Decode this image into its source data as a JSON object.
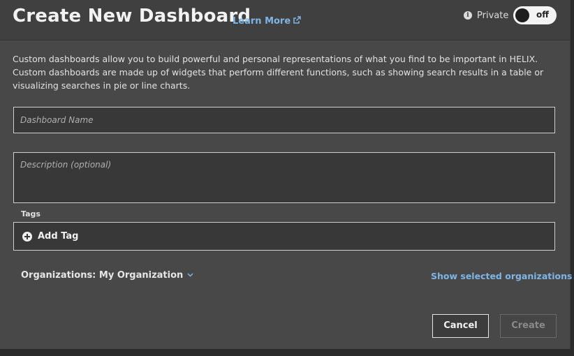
{
  "header": {
    "title": "Create New Dashboard",
    "learn_more": "Learn More",
    "learn_more_icon": "external-link-icon",
    "private_label": "Private",
    "private_icon": "info-icon",
    "toggle_state": "off"
  },
  "description": "Custom dashboards allow you to build powerful and personal representations of what you find to be important in HELIX. Custom dashboards are made up of widgets that perform different functions, such as showing search results in a table or visualizing searches in pie or line charts.",
  "form": {
    "name_placeholder": "Dashboard Name",
    "name_value": "",
    "description_placeholder": "Description (optional)",
    "description_value": "",
    "tags_label": "Tags",
    "add_tag_label": "Add Tag",
    "organizations_label": "Organizations: My Organization",
    "show_selected_orgs": "Show selected organizations"
  },
  "buttons": {
    "cancel": "Cancel",
    "create": "Create"
  },
  "colors": {
    "accent_link": "#7fb5e6",
    "panel_bg": "#484848",
    "header_bg": "#404040"
  }
}
